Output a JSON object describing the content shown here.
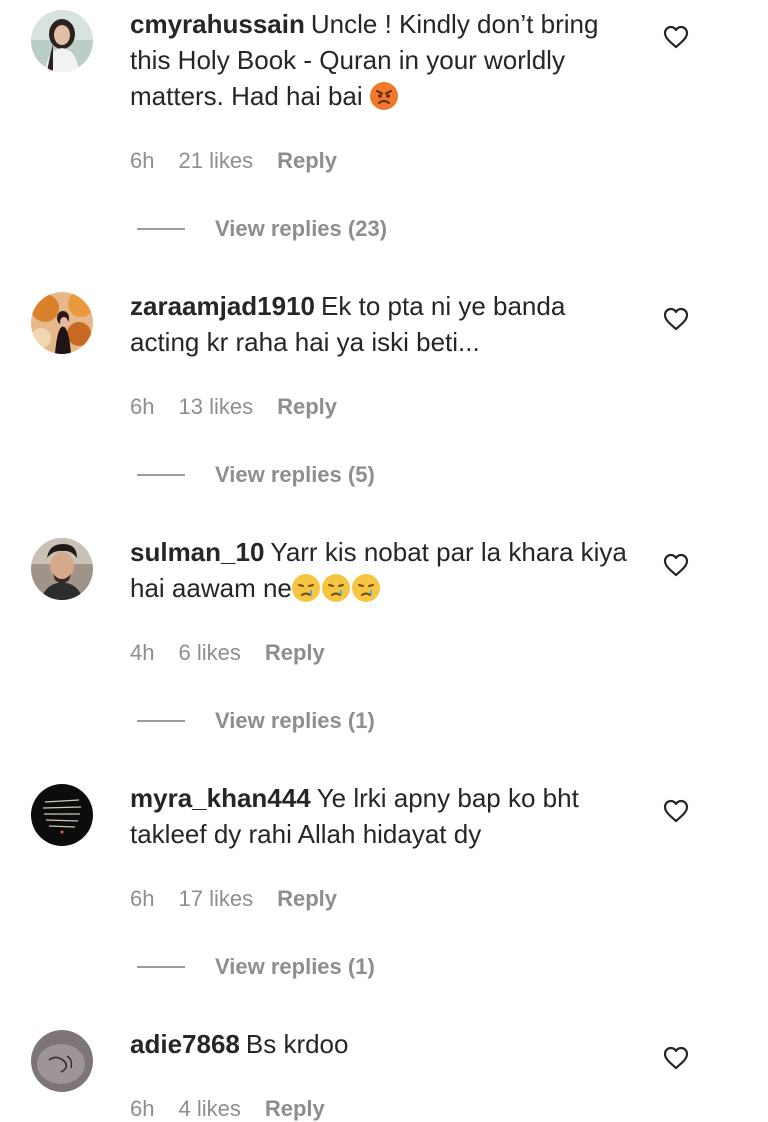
{
  "comments": [
    {
      "username": "cmyrahussain",
      "text": "Uncle ! Kindly don’t bring this Holy Book - Quran in your worldly matters. Had hai bai",
      "emoji": "angry-face",
      "time": "6h",
      "likes": "21 likes",
      "reply": "Reply",
      "view_replies": "View replies (23)"
    },
    {
      "username": "zaraamjad1910",
      "text": "Ek to pta ni ye banda acting kr raha hai ya iski beti...",
      "time": "6h",
      "likes": "13 likes",
      "reply": "Reply",
      "view_replies": "View replies (5)"
    },
    {
      "username": "sulman_10",
      "text": "Yarr kis nobat par la khara kiya hai aawam ne",
      "emoji": "crying-face x3",
      "time": "4h",
      "likes": "6 likes",
      "reply": "Reply",
      "view_replies": "View replies (1)"
    },
    {
      "username": "myra_khan444",
      "text": "Ye lrki apny bap ko bht takleef dy rahi Allah hidayat dy",
      "time": "6h",
      "likes": "17 likes",
      "reply": "Reply",
      "view_replies": "View replies (1)"
    },
    {
      "username": "adie7868",
      "text": "Bs krdoo",
      "time": "6h",
      "likes": "4 likes",
      "reply": "Reply"
    }
  ],
  "icons": {
    "like": "heart-outline-icon"
  },
  "colors": {
    "text": "#262626",
    "secondary": "#8e8e8e",
    "background": "#ffffff"
  }
}
